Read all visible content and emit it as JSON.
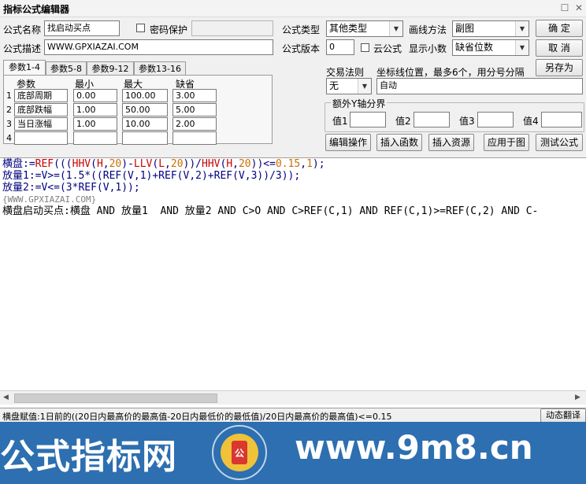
{
  "window": {
    "title": "指标公式编辑器",
    "close_glyph": "☐",
    "x_glyph": "✕"
  },
  "form": {
    "name_label": "公式名称",
    "name_value": "找启动买点",
    "password_label": "密码保护",
    "desc_label": "公式描述",
    "desc_value": "WWW.GPXIAZAI.COM",
    "type_label": "公式类型",
    "type_value": "其他类型",
    "draw_label": "画线方法",
    "draw_value": "副图",
    "version_label": "公式版本",
    "version_value": "0",
    "cloud_label": "云公式",
    "decimal_label": "显示小数",
    "decimal_value": "缺省位数"
  },
  "buttons": {
    "ok": "确  定",
    "cancel": "取  消",
    "save_as": "另存为",
    "edit_ops": "编辑操作",
    "insert_fn": "插入函数",
    "insert_res": "插入资源",
    "apply_chart": "应用于图",
    "test_formula": "测试公式"
  },
  "tabs": [
    "参数1-4",
    "参数5-8",
    "参数9-12",
    "参数13-16"
  ],
  "params": {
    "headers": [
      "参数",
      "最小",
      "最大",
      "缺省"
    ],
    "rows": [
      {
        "n": "1",
        "name": "底部周期",
        "min": "0.00",
        "max": "100.00",
        "def": "3.00"
      },
      {
        "n": "2",
        "name": "底部跌幅",
        "min": "1.00",
        "max": "50.00",
        "def": "5.00"
      },
      {
        "n": "3",
        "name": "当日涨幅",
        "min": "1.00",
        "max": "10.00",
        "def": "2.00"
      },
      {
        "n": "4",
        "name": "",
        "min": "",
        "max": "",
        "def": ""
      }
    ]
  },
  "trade": {
    "rule_label": "交易法则",
    "rule_value": "无",
    "coord_label": "坐标线位置，最多6个，用分号分隔",
    "coord_value": "自动"
  },
  "yaxis": {
    "group_label": "额外Y轴分界",
    "labels": [
      "值1",
      "值2",
      "值3",
      "值4"
    ]
  },
  "code": {
    "line1": {
      "a": "横盘:=",
      "b": "REF",
      "c": "(((",
      "d": "HHV",
      "e": "(",
      "f": "H",
      "g": ",",
      "h": "20",
      "i": ")-",
      "j": "LLV",
      "k": "(",
      "l": "L",
      "m": ",",
      "n": "20",
      "o": "))/",
      "p": "HHV",
      "q": "(",
      "r": "H",
      "s": ",",
      "t": "20",
      "u": "))<=",
      "v": "0.15",
      "w": ",",
      "x": "1",
      "y": ");"
    },
    "line2": "放量1:=V>=(1.5*((REF(V,1)+REF(V,2)+REF(V,3))/3));",
    "line3": "放量2:=V<=(3*REF(V,1));",
    "comment": "{WWW.GPXIAZAI.COM}",
    "line5": "横盘启动买点:横盘 AND 放量1  AND 放量2 AND C>O AND C>REF(C,1) AND REF(C,1)>=REF(C,2) AND C-"
  },
  "status": {
    "text": "横盘赋值:1日前的((20日内最高价的最高值-20日内最低价的最低值)/20日内最高价的最高值)<=0.15",
    "translate_btn": "动态翻译"
  },
  "watermark": {
    "left": "公式指标网",
    "right": "www.9m8.cn",
    "seal_text": "www.9m8.cn"
  }
}
